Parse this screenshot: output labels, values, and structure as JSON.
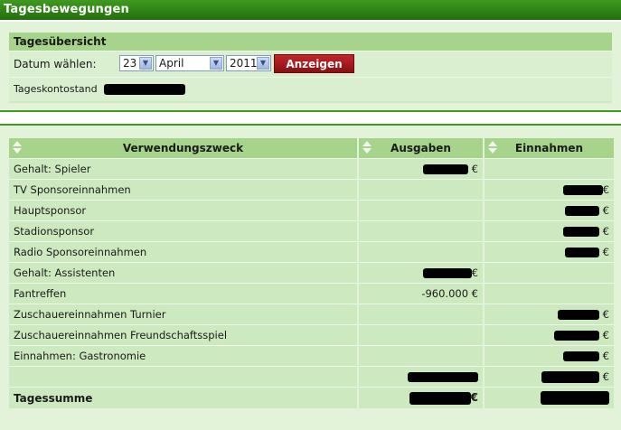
{
  "title": "Tagesbewegungen",
  "overview": {
    "heading": "Tagesübersicht",
    "date_label": "Datum wählen:",
    "day": "23",
    "month": "April",
    "year": "2011",
    "show_button": "Anzeigen",
    "balance_label": "Tageskontostand"
  },
  "table": {
    "columns": [
      "Verwendungszweck",
      "Ausgaben",
      "Einnahmen"
    ],
    "rows": [
      {
        "purpose": "Gehalt: Spieler",
        "expense": "€",
        "income": ""
      },
      {
        "purpose": "TV Sponsoreinnahmen",
        "expense": "",
        "income": "€"
      },
      {
        "purpose": "Hauptsponsor",
        "expense": "",
        "income": "€"
      },
      {
        "purpose": "Stadionsponsor",
        "expense": "",
        "income": "€"
      },
      {
        "purpose": "Radio Sponsoreinnahmen",
        "expense": "",
        "income": "€"
      },
      {
        "purpose": "Gehalt: Assistenten",
        "expense": "€",
        "income": ""
      },
      {
        "purpose": "Fantreffen",
        "expense": "-960.000 €",
        "income": ""
      },
      {
        "purpose": "Zuschauereinnahmen Turnier",
        "expense": "",
        "income": "€"
      },
      {
        "purpose": "Zuschauereinnahmen Freundschaftsspiel",
        "expense": "",
        "income": "€"
      },
      {
        "purpose": "Einnahmen: Gastronomie",
        "expense": "",
        "income": "€"
      }
    ],
    "sum_row": {
      "purpose": "",
      "expense": "",
      "income": "€"
    },
    "total_row": {
      "purpose": "Tagessumme",
      "expense": "€",
      "income": ""
    }
  }
}
